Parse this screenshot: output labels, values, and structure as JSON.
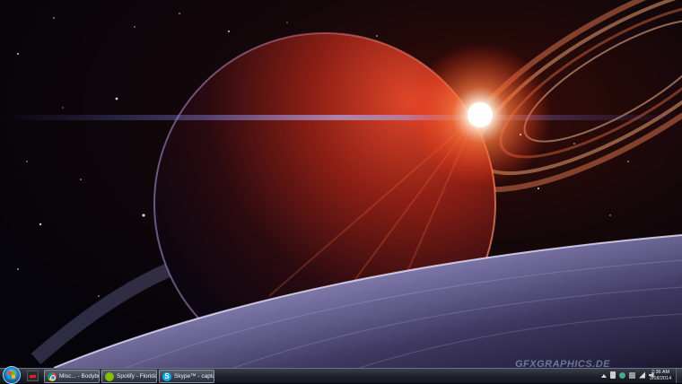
{
  "wallpaper": {
    "description_icon": "space-planet-wallpaper",
    "watermark": "GFXGRAPHICS.DE"
  },
  "taskbar": {
    "start_icon": "windows-start-orb",
    "pinned": [
      {
        "icon": "app-icon-dark-red"
      }
    ],
    "buttons": [
      {
        "icon": "chrome-icon",
        "label": "Misc... - Bodybuildi..."
      },
      {
        "icon": "spotify-icon",
        "label": "Spotify - Florida G..."
      },
      {
        "icon": "skype-icon",
        "label": "Skype™ - captainc..."
      }
    ],
    "tray_icons": [
      "show-hidden-icons",
      "tray-app-icon",
      "tray-network-icon",
      "tray-flag-icon",
      "tray-signal-icon",
      "volume-icon"
    ],
    "clock": {
      "time": "2:36 AM",
      "date": "3/18/2014"
    }
  },
  "colors": {
    "taskbar_top": "#3a3e4a",
    "taskbar_bottom": "#141720",
    "planet_red": "#a8281c",
    "flare": "#ffffff"
  }
}
